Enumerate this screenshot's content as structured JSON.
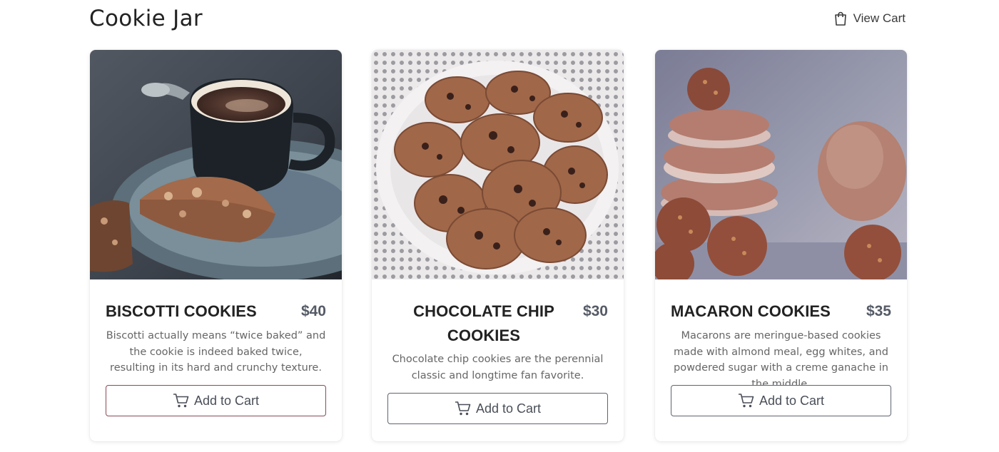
{
  "header": {
    "title": "Cookie Jar",
    "view_cart_label": "View Cart",
    "view_cart_icon": "shopping-bag-icon"
  },
  "products": [
    {
      "name": "BISCOTTI COOKIES",
      "price": "$40",
      "description": "Biscotti actually means “twice baked” and the cookie is indeed baked twice, resulting in its hard and crunchy texture.",
      "button_label": "Add to Cart",
      "image": "biscotti-with-espresso-photo"
    },
    {
      "name": "CHOCOLATE CHIP COOKIES",
      "price": "$30",
      "description": "Chocolate chip cookies are the perennial classic and longtime fan favorite.",
      "button_label": "Add to Cart",
      "image": "chocolate-chip-cookies-on-doily-photo"
    },
    {
      "name": "MACARON COOKIES",
      "price": "$35",
      "description": "Macarons are meringue-based cookies made with almond meal, egg whites, and powdered sugar with a creme ganache in the middle.",
      "button_label": "Add to Cart",
      "image": "macaron-stack-photo"
    }
  ],
  "colors": {
    "text": "#222222",
    "price": "#555b66",
    "description": "#666666",
    "button_border": "#5e6470"
  }
}
